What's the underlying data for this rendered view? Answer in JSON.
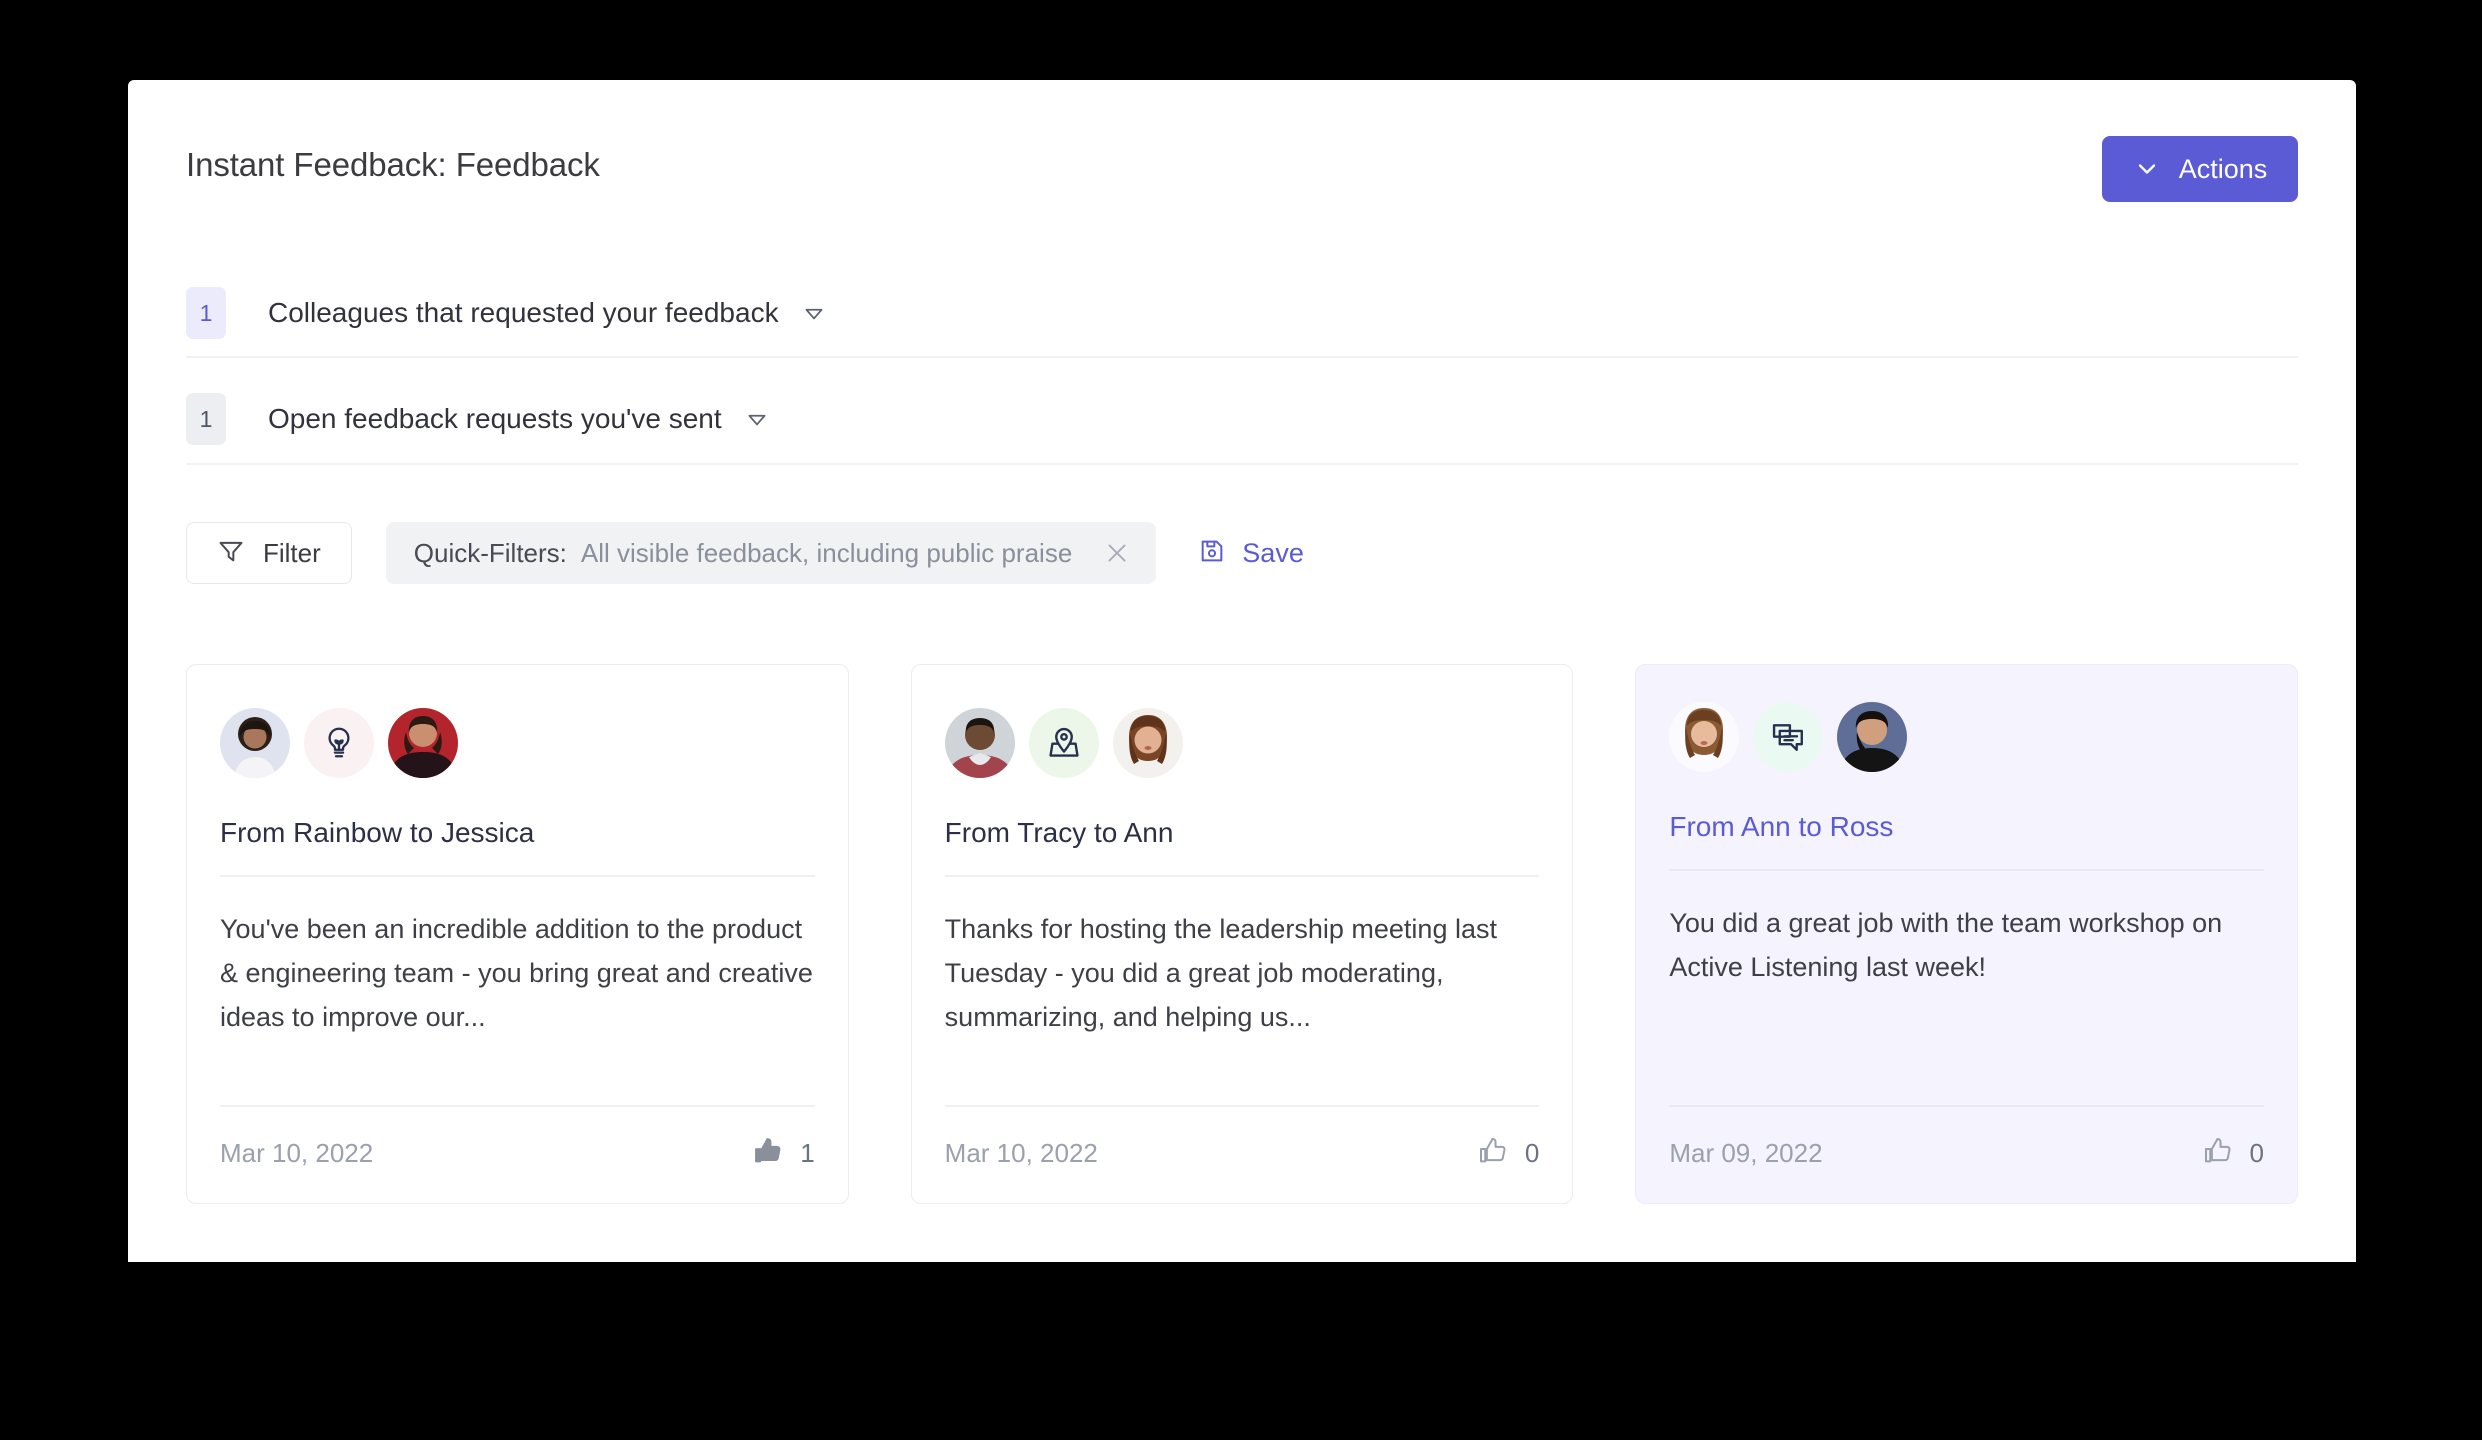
{
  "header": {
    "title": "Instant Feedback: Feedback",
    "actions_button": {
      "label": "Actions",
      "icon": "chevron-down-icon",
      "color": "#5b5bd6"
    }
  },
  "sections": [
    {
      "count": "1",
      "label": "Colleagues that requested your feedback",
      "badge_style": "accent",
      "badge_bg": "#ebebfb",
      "badge_color": "#5b5bd6",
      "caret": "caret-down-icon"
    },
    {
      "count": "1",
      "label": "Open feedback requests you've sent",
      "badge_style": "muted",
      "badge_bg": "#eceef1",
      "badge_color": "#4e5766",
      "caret": "caret-down-icon"
    }
  ],
  "filter_bar": {
    "filter_button": {
      "label": "Filter",
      "icon": "funnel-icon"
    },
    "quick_filter": {
      "key": "Quick-Filters:",
      "value": "All visible feedback, including public praise",
      "clear_icon": "close-icon"
    },
    "save": {
      "label": "Save",
      "icon": "save-disk-icon",
      "color": "#5b5bd6"
    }
  },
  "cards": [
    {
      "title": "From Rainbow to Jessica",
      "body": "You've been an incredible addition to the product & engineering team - you bring great and creative ideas to improve our...",
      "date": "Mar 10, 2022",
      "likes": "1",
      "like_icon": "thumbs-up-filled-icon",
      "topic_icon": "lightbulb-icon",
      "topic_icon_bg": "#faf1f2",
      "highlighted": false,
      "from_avatar": "avatar-rainbow",
      "to_avatar": "avatar-jessica"
    },
    {
      "title": "From Tracy to Ann",
      "body": "Thanks for hosting the leadership meeting last Tuesday - you did a great job moderating, summarizing, and helping us...",
      "date": "Mar 10, 2022",
      "likes": "0",
      "like_icon": "thumbs-up-outline-icon",
      "topic_icon": "map-pin-icon",
      "topic_icon_bg": "#edf7e9",
      "highlighted": false,
      "from_avatar": "avatar-tracy",
      "to_avatar": "avatar-ann"
    },
    {
      "title": "From Ann to Ross",
      "body": "You did a great job with the team workshop on Active Listening last week!",
      "date": "Mar 09, 2022",
      "likes": "0",
      "like_icon": "thumbs-up-outline-icon",
      "topic_icon": "chat-bubbles-icon",
      "topic_icon_bg": "#eafaf2",
      "highlighted": true,
      "from_avatar": "avatar-ann",
      "to_avatar": "avatar-ross"
    }
  ]
}
